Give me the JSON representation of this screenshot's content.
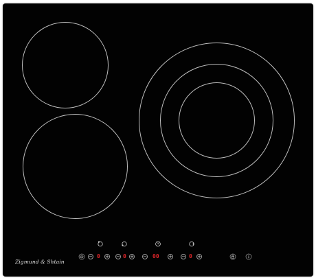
{
  "brand": {
    "text": "Zigmund & Shtain"
  },
  "cooking_zones": [
    {
      "name": "rear-left-zone",
      "rings": 1
    },
    {
      "name": "front-left-zone",
      "rings": 1
    },
    {
      "name": "right-triple-zone",
      "rings": 3
    }
  ],
  "controls": {
    "minus_label": "−",
    "plus_label": "+",
    "zone_1": {
      "level": "0"
    },
    "zone_2": {
      "level": "0"
    },
    "timer": {
      "value": "00"
    },
    "zone_3": {
      "level": "0"
    }
  },
  "colors": {
    "glass": "#020202",
    "ring": "#bdbdbd",
    "display": "#e0262a",
    "icon": "#d8d8d8"
  },
  "icons": {
    "zone_selector": "zone-selector-icon",
    "timer": "clock-icon",
    "power": "power-icon",
    "lock": "lock-icon",
    "info": "info-icon"
  }
}
